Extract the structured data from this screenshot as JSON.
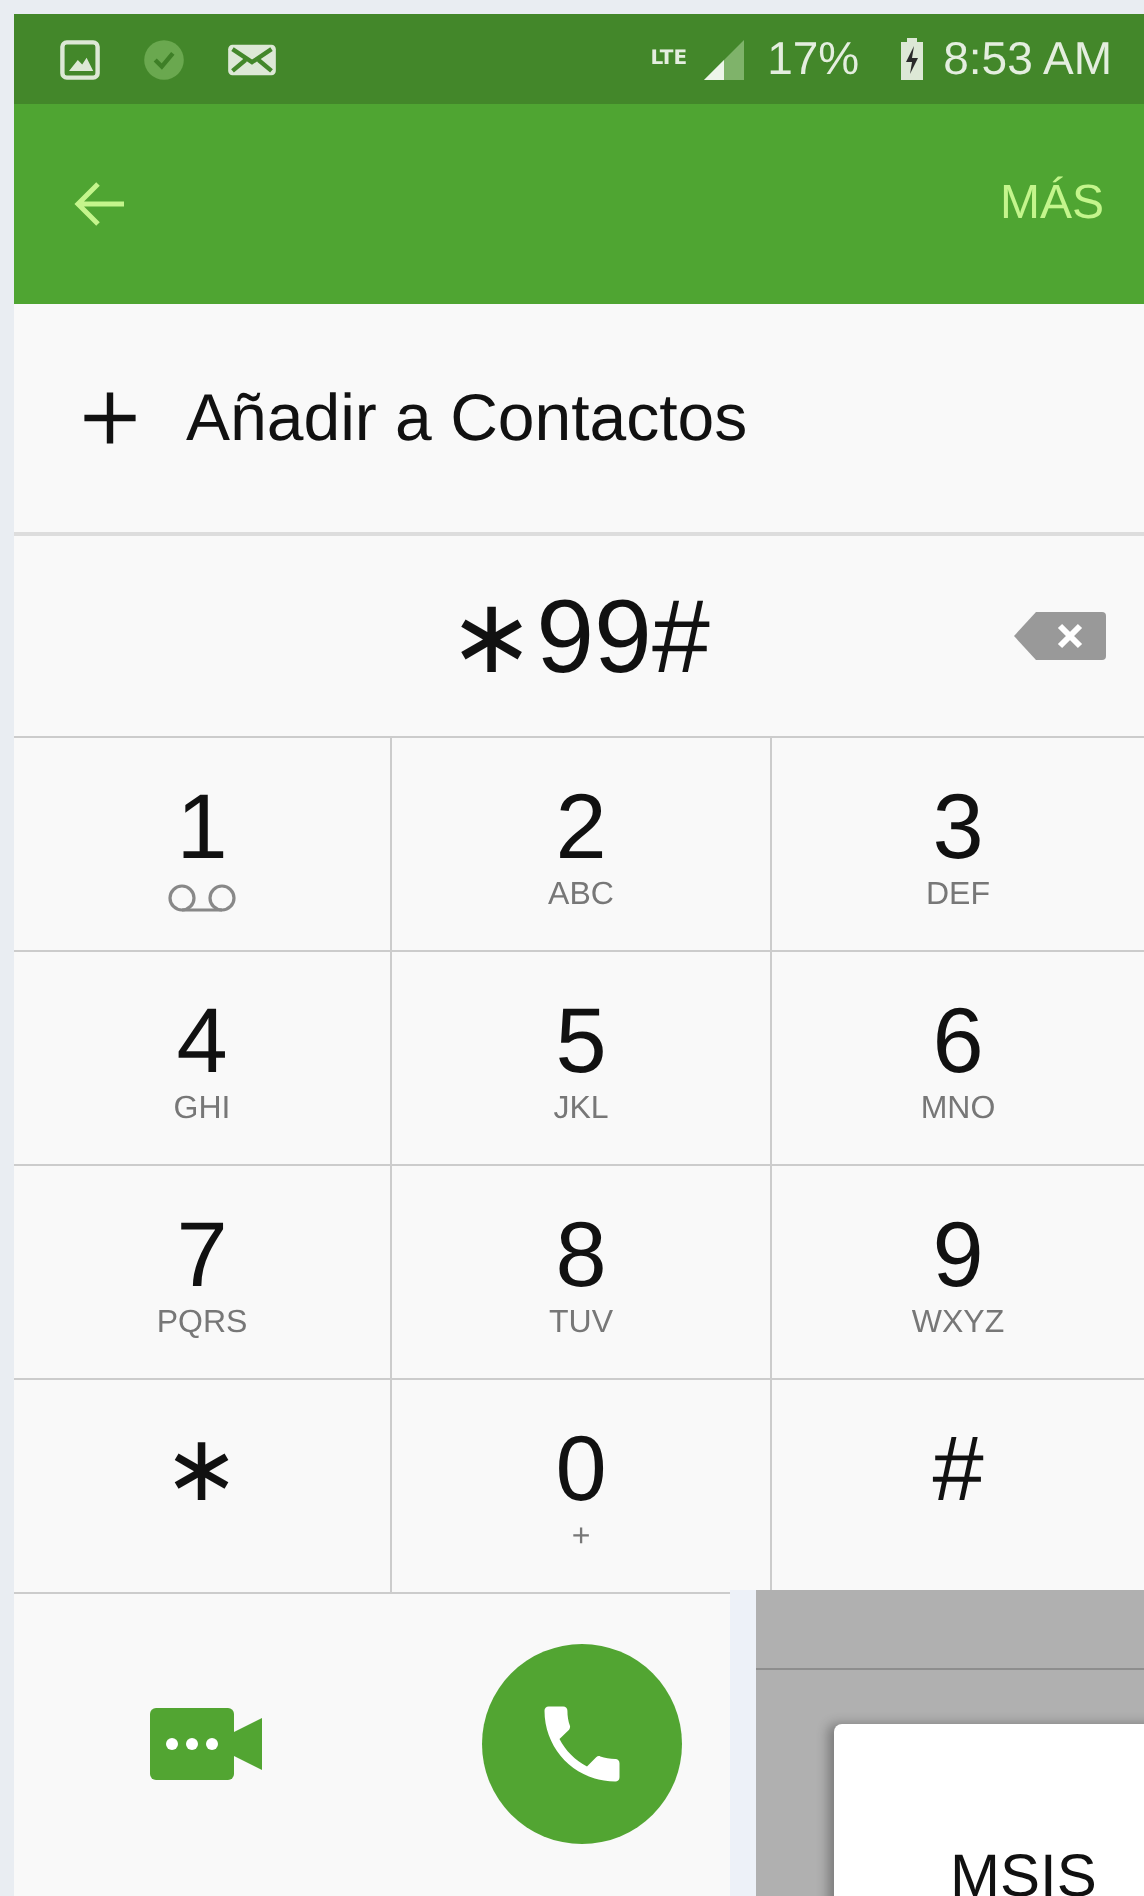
{
  "status_bar": {
    "network": "LTE",
    "battery": "17%",
    "time": "8:53 AM"
  },
  "app_bar": {
    "action": "MÁS"
  },
  "add_contact": {
    "label": "Añadir a Contactos"
  },
  "dialed_number": "∗99#",
  "keypad": [
    {
      "digit": "1",
      "kind": "voicemail"
    },
    {
      "digit": "2",
      "kind": "letters",
      "letters": "ABC"
    },
    {
      "digit": "3",
      "kind": "letters",
      "letters": "DEF"
    },
    {
      "digit": "4",
      "kind": "letters",
      "letters": "GHI"
    },
    {
      "digit": "5",
      "kind": "letters",
      "letters": "JKL"
    },
    {
      "digit": "6",
      "kind": "letters",
      "letters": "MNO"
    },
    {
      "digit": "7",
      "kind": "letters",
      "letters": "PQRS"
    },
    {
      "digit": "8",
      "kind": "letters",
      "letters": "TUV"
    },
    {
      "digit": "9",
      "kind": "letters",
      "letters": "WXYZ"
    },
    {
      "digit": "∗",
      "kind": "symbol"
    },
    {
      "digit": "0",
      "kind": "letters",
      "letters": "+"
    },
    {
      "digit": "#",
      "kind": "symbol"
    }
  ],
  "overlay_window": {
    "text": "MSIS"
  }
}
